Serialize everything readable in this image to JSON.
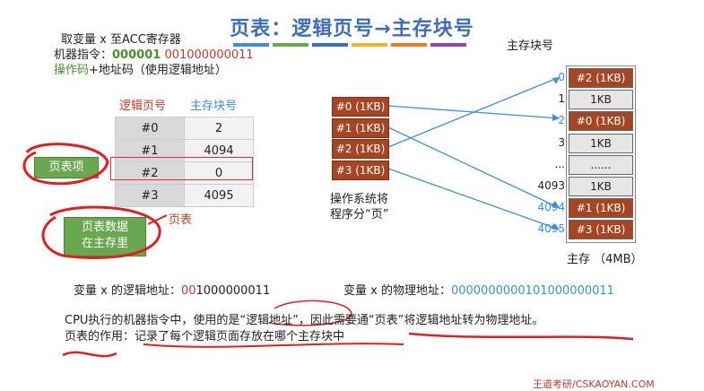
{
  "title": "页表：逻辑页号→主存块号",
  "title_bar_colors": [
    "#3d8fd6",
    "#6aa84f",
    "#3f6fb2",
    "#f0b429",
    "#e67e22",
    "#8e44ad"
  ],
  "intro": {
    "line1": "取变量 x 至ACC寄存器",
    "line2_prefix": "机器指令：",
    "line2_opcode": "000001",
    "line2_addr": "001000000011",
    "line3_opcode_label": "操作码",
    "line3_rest": "+地址码（使用逻辑地址）"
  },
  "page_table": {
    "header_logical": "逻辑页号",
    "header_block": "主存块号",
    "rows": [
      {
        "page": "#0",
        "block": "2"
      },
      {
        "page": "#1",
        "block": "4094"
      },
      {
        "page": "#2",
        "block": "0"
      },
      {
        "page": "#3",
        "block": "4095"
      }
    ]
  },
  "notes": {
    "page_entry": "页表项",
    "page_table_in_memory_1": "页表数据",
    "page_table_in_memory_2": "在主存里",
    "page_table_label": "页表",
    "os_note_1": "操作系统将",
    "os_note_2": "程序分“页”"
  },
  "logical_pages": [
    "#0 (1KB)",
    "#1 (1KB)",
    "#2 (1KB)",
    "#3 (1KB)"
  ],
  "memory": {
    "header": "主存块号",
    "caption": "主存 （4MB）",
    "rows": [
      {
        "label": "0",
        "cell": "#2 (1KB)",
        "kind": "brown",
        "label_color": "blue"
      },
      {
        "label": "1",
        "cell": "1KB",
        "kind": "grey",
        "label_color": "black"
      },
      {
        "label": "2",
        "cell": "#0 (1KB)",
        "kind": "brown",
        "label_color": "blue"
      },
      {
        "label": "3",
        "cell": "1KB",
        "kind": "grey",
        "label_color": "black"
      },
      {
        "label": "...",
        "cell": "......",
        "kind": "grey",
        "label_color": "black"
      },
      {
        "label": "4093",
        "cell": "1KB",
        "kind": "grey",
        "label_color": "black"
      },
      {
        "label": "4094",
        "cell": "#1 (1KB)",
        "kind": "brown",
        "label_color": "blue"
      },
      {
        "label": "4095",
        "cell": "#3 (1KB)",
        "kind": "brown",
        "label_color": "blue"
      }
    ]
  },
  "logical_address": {
    "label": "变量 x 的逻辑地址：",
    "prefix": "00",
    "rest": "1000000011"
  },
  "physical_address": {
    "label": "变量 x 的物理地址：",
    "value": "0000000000101000000011"
  },
  "paragraph": {
    "line1": "CPU执行的机器指令中，使用的是“逻辑地址”，因此需要通“页表”将逻辑地址转为物理地址。",
    "line2": "页表的作用：记录了每个逻辑页面存放在哪个主存块中"
  },
  "footer": "王道考研/CSKAOYAN.COM"
}
